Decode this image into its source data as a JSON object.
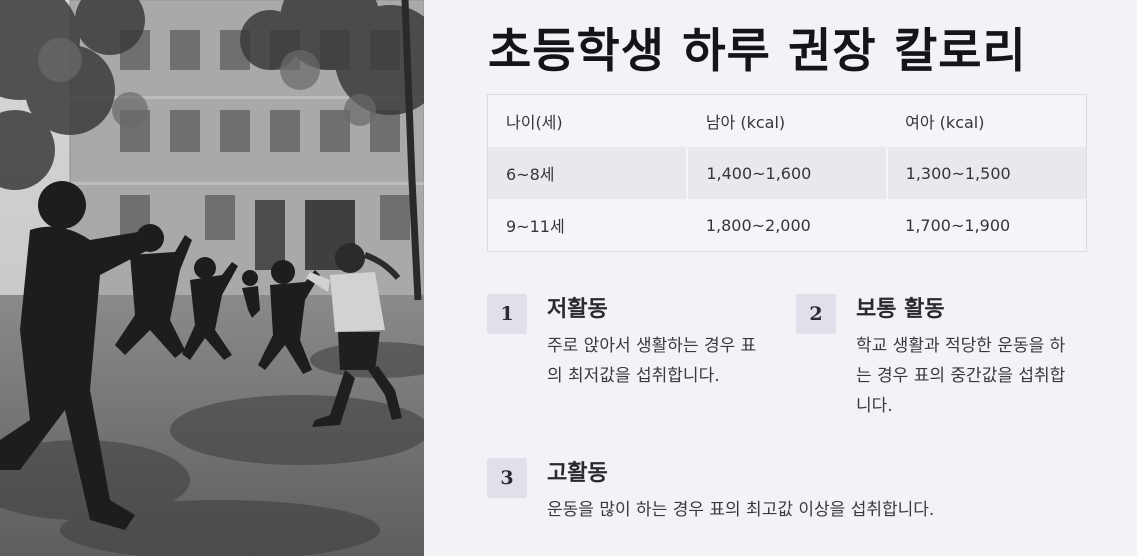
{
  "title": "초등학생 하루 권장 칼로리",
  "table": {
    "headers": [
      "나이(세)",
      "남아 (kcal)",
      "여아 (kcal)"
    ],
    "rows": [
      [
        "6~8세",
        "1,400~1,600",
        "1,300~1,500"
      ],
      [
        "9~11세",
        "1,800~2,000",
        "1,700~1,900"
      ]
    ]
  },
  "activities": [
    {
      "number": "1",
      "title": "저활동",
      "desc": "주로 앉아서 생활하는 경우 표의 최저값을 섭취합니다."
    },
    {
      "number": "2",
      "title": "보통 활동",
      "desc": "학교 생활과 적당한 운동을 하는 경우 표의 중간값을 섭취합니다."
    },
    {
      "number": "3",
      "title": "고활동",
      "desc": "운동을 많이 하는 경우 표의 최고값 이상을 섭취합니다."
    }
  ]
}
